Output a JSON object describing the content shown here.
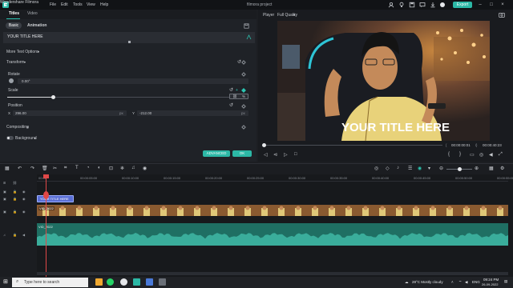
{
  "app": {
    "name": "Wondershare Filmora",
    "project": "filmora project",
    "menu": [
      "File",
      "Edit",
      "Tools",
      "View",
      "Help"
    ],
    "export_label": "Export"
  },
  "editor": {
    "tabs": [
      "Titles",
      "Video"
    ],
    "subtabs": [
      "Basic",
      "Animation"
    ],
    "title_text": "YOUR TITLE HERE",
    "more_text_options": "More Text Options",
    "transform": "Transform",
    "rotate_label": "Rotate",
    "rotate_value": "0.00°",
    "scale_label": "Scale",
    "scale_level_fraction": 0.19,
    "position_label": "Position",
    "pos_x_label": "X",
    "pos_x_value": "296.00",
    "pos_y_label": "Y",
    "pos_y_value": "-212.00",
    "unit": "px",
    "compositing": "Compositing",
    "background": "Background",
    "advanced_label": "ADVANCED",
    "ok_label": "OK"
  },
  "player": {
    "label": "Player",
    "quality": "Full Quality",
    "overlay_title": "YOUR TITLE HERE",
    "timecode_current": "00:00:00:01",
    "timecode_total": "00:00:40:23",
    "progress_fraction": 0.0
  },
  "timeline": {
    "ruler_ticks": [
      "00:00",
      "00:00:05:00",
      "00:00:10:00",
      "00:00:15:00",
      "00:00:20:00",
      "00:00:25:00",
      "00:00:30:00",
      "00:00:35:00",
      "00:00:40:00",
      "00:00:45:00",
      "00:00:50:00",
      "00:00:55:00"
    ],
    "title_clip_label": "YOUR TITLE HERE",
    "video_clip_label": "VID_2022",
    "audio_clip_label": "VID_2022"
  },
  "taskbar": {
    "search_placeholder": "Type here to search",
    "weather": "28°C  Mostly cloudy",
    "lang": "ENG",
    "time": "09:24 PM",
    "date": "26-09-2022"
  },
  "colors": {
    "accent": "#2cb8a6",
    "playhead": "#e04848",
    "title_clip": "#5a6fd6",
    "audio_clip": "#1f6f63"
  }
}
